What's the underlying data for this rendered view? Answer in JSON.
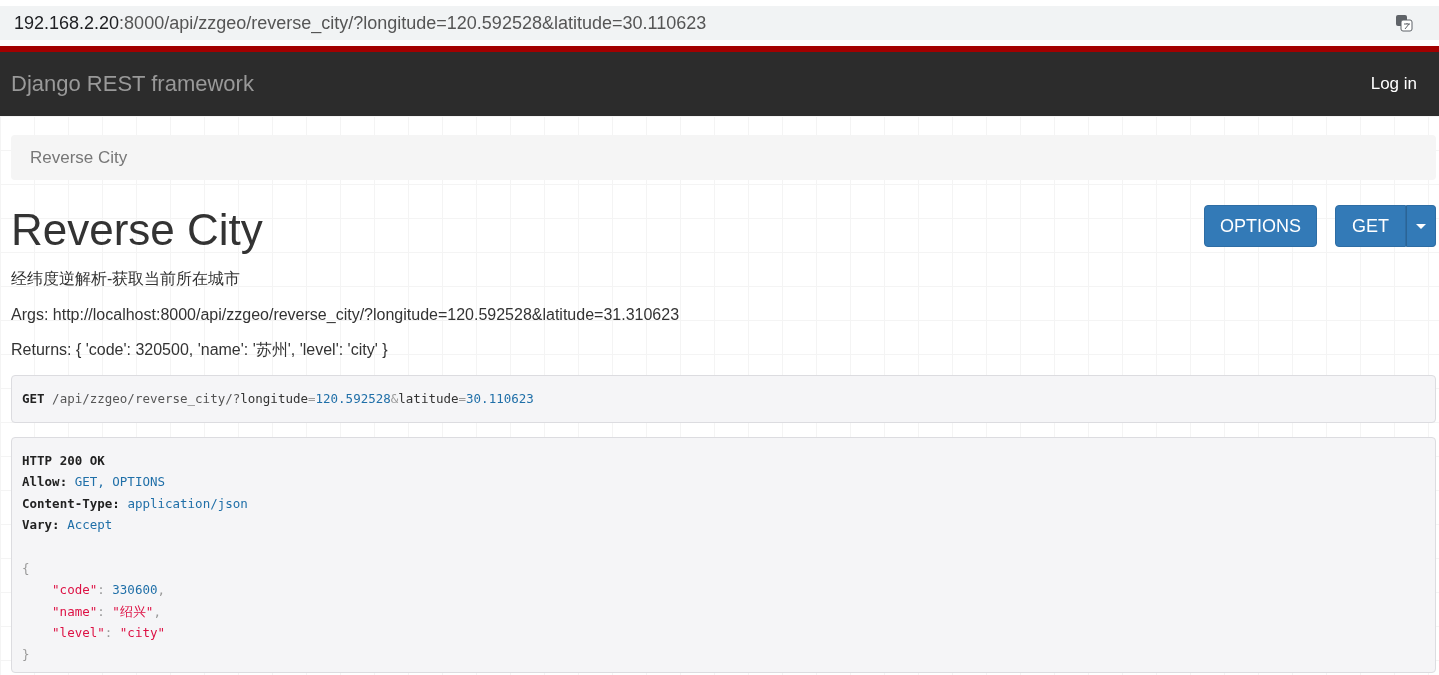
{
  "address_bar": {
    "host": "192.168.2.20",
    "rest": ":8000/api/zzgeo/reverse_city/?longitude=120.592528&latitude=30.110623"
  },
  "navbar": {
    "brand": "Django REST framework",
    "login": "Log in"
  },
  "breadcrumb": [
    "Reverse City"
  ],
  "title": "Reverse City",
  "buttons": {
    "options": "OPTIONS",
    "get": "GET"
  },
  "description": [
    "经纬度逆解析-获取当前所在城市",
    "Args: http://localhost:8000/api/zzgeo/reverse_city/?longitude=120.592528&latitude=31.310623",
    "Returns: { 'code': 320500, 'name': '苏州', 'level': 'city' }"
  ],
  "request": [
    {
      "text": "GET",
      "kind": "method"
    },
    {
      "text": " /api/zzgeo/reverse_city/?",
      "kind": "path"
    },
    {
      "text": "longitude",
      "kind": "plain"
    },
    {
      "text": "=",
      "kind": "punct"
    },
    {
      "text": "120.592528",
      "kind": "num"
    },
    {
      "text": "&",
      "kind": "punct"
    },
    {
      "text": "latitude",
      "kind": "plain"
    },
    {
      "text": "=",
      "kind": "punct"
    },
    {
      "text": "30.110623",
      "kind": "num"
    }
  ],
  "response": {
    "status": "HTTP 200 OK",
    "headers": [
      {
        "name": "Allow:",
        "value": "GET, OPTIONS"
      },
      {
        "name": "Content-Type:",
        "value": "application/json"
      },
      {
        "name": "Vary:",
        "value": "Accept"
      }
    ],
    "body": {
      "open": "{",
      "close": "}",
      "children": [
        [
          {
            "text": "\"code\"",
            "kind": "str"
          },
          {
            "text": ": ",
            "kind": "punct"
          },
          {
            "text": "330600",
            "kind": "num"
          },
          {
            "text": ",",
            "kind": "punct"
          }
        ],
        [
          {
            "text": "\"name\"",
            "kind": "str"
          },
          {
            "text": ": ",
            "kind": "punct"
          },
          {
            "text": "\"绍兴\"",
            "kind": "str"
          },
          {
            "text": ",",
            "kind": "punct"
          }
        ],
        [
          {
            "text": "\"level\"",
            "kind": "str"
          },
          {
            "text": ": ",
            "kind": "punct"
          },
          {
            "text": "\"city\"",
            "kind": "str"
          }
        ]
      ]
    }
  }
}
